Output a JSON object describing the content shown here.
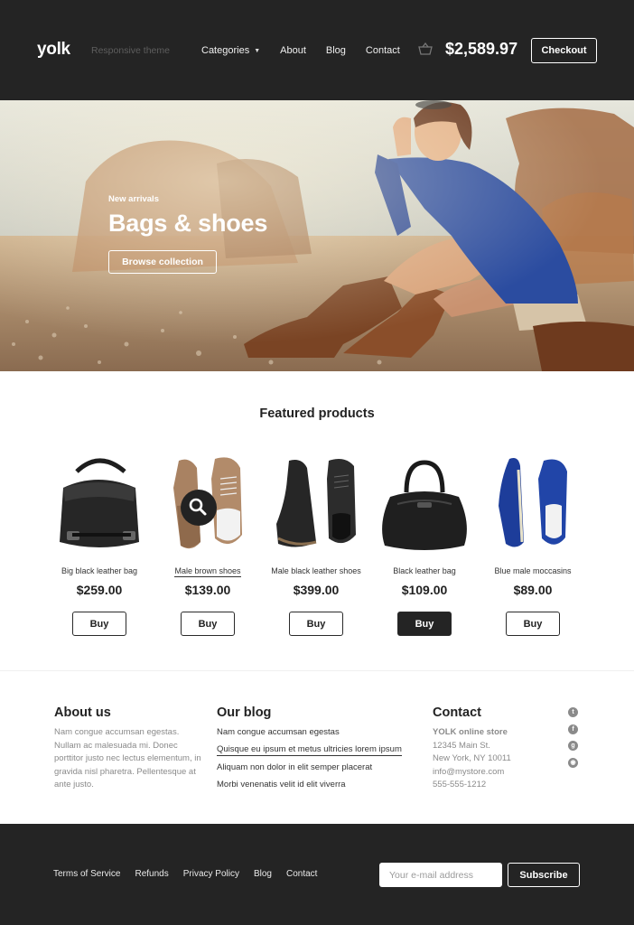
{
  "header": {
    "logo": "yolk",
    "tagline": "Responsive theme",
    "nav": [
      {
        "label": "Categories"
      },
      {
        "label": "About"
      },
      {
        "label": "Blog"
      },
      {
        "label": "Contact"
      }
    ],
    "cart_total": "$2,589.97",
    "checkout_label": "Checkout"
  },
  "hero": {
    "eyebrow": "New arrivals",
    "title": "Bags & shoes",
    "button_label": "Browse collection"
  },
  "featured": {
    "title": "Featured products",
    "products": [
      {
        "name": "Big black leather bag",
        "price": "$259.00",
        "buy_label": "Buy"
      },
      {
        "name": "Male brown shoes",
        "price": "$139.00",
        "buy_label": "Buy"
      },
      {
        "name": "Male black leather shoes",
        "price": "$399.00",
        "buy_label": "Buy"
      },
      {
        "name": "Black leather bag",
        "price": "$109.00",
        "buy_label": "Buy"
      },
      {
        "name": "Blue male moccasins",
        "price": "$89.00",
        "buy_label": "Buy"
      }
    ]
  },
  "about": {
    "title": "About us",
    "text": "Nam congue accumsan egestas. Nullam ac malesuada mi. Donec porttitor justo nec lectus elementum, in gravida nisl pharetra. Pellentesque at ante justo."
  },
  "blog": {
    "title": "Our blog",
    "items": [
      "Nam congue accumsan egestas",
      "Quisque eu ipsum et metus ultricies lorem ipsum",
      "Aliquam non dolor in elit semper placerat",
      "Morbi venenatis velit id elit viverra"
    ]
  },
  "contact": {
    "title": "Contact",
    "store": "YOLK online store",
    "street": "12345 Main St.",
    "city": "New York, NY 10011",
    "email": "info@mystore.com",
    "phone": "555-555-1212",
    "social_icons": [
      "twitter-icon",
      "facebook-icon",
      "google-plus-icon",
      "rss-icon"
    ]
  },
  "footer": {
    "links": [
      "Terms of Service",
      "Refunds",
      "Privacy Policy",
      "Blog",
      "Contact"
    ],
    "email_placeholder": "Your e-mail address",
    "subscribe_label": "Subscribe"
  },
  "colors": {
    "dark": "#242424",
    "muted_text": "#8a8a8a",
    "white": "#ffffff"
  }
}
